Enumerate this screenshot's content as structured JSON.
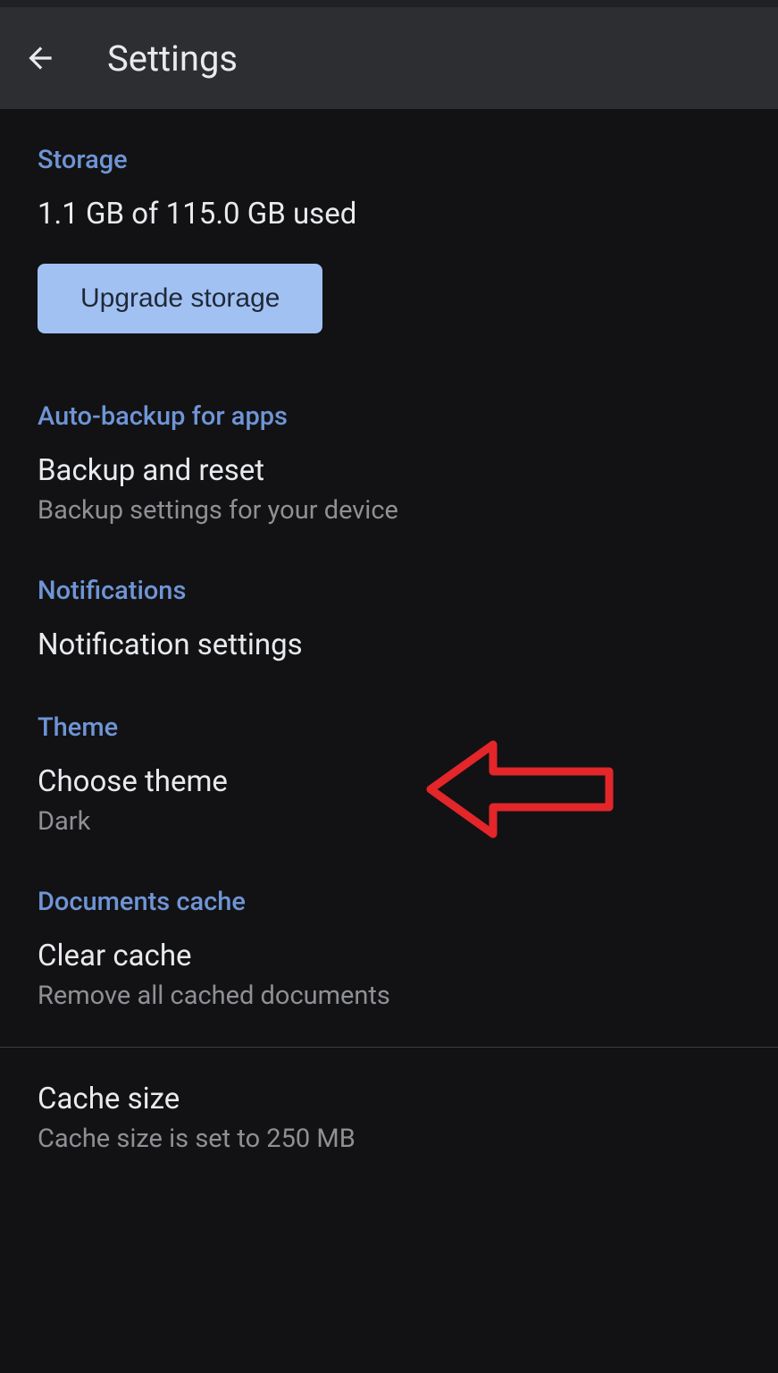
{
  "header": {
    "title": "Settings"
  },
  "sections": {
    "storage": {
      "header": "Storage",
      "usage": "1.1 GB of 115.0 GB used",
      "upgrade_label": "Upgrade storage"
    },
    "autobackup": {
      "header": "Auto-backup for apps",
      "item_title": "Backup and reset",
      "item_subtitle": "Backup settings for your device"
    },
    "notifications": {
      "header": "Notifications",
      "item_title": "Notification settings"
    },
    "theme": {
      "header": "Theme",
      "item_title": "Choose theme",
      "item_subtitle": "Dark"
    },
    "documents_cache": {
      "header": "Documents cache",
      "clear_title": "Clear cache",
      "clear_subtitle": "Remove all cached documents",
      "size_title": "Cache size",
      "size_subtitle": "Cache size is set to 250 MB"
    }
  }
}
